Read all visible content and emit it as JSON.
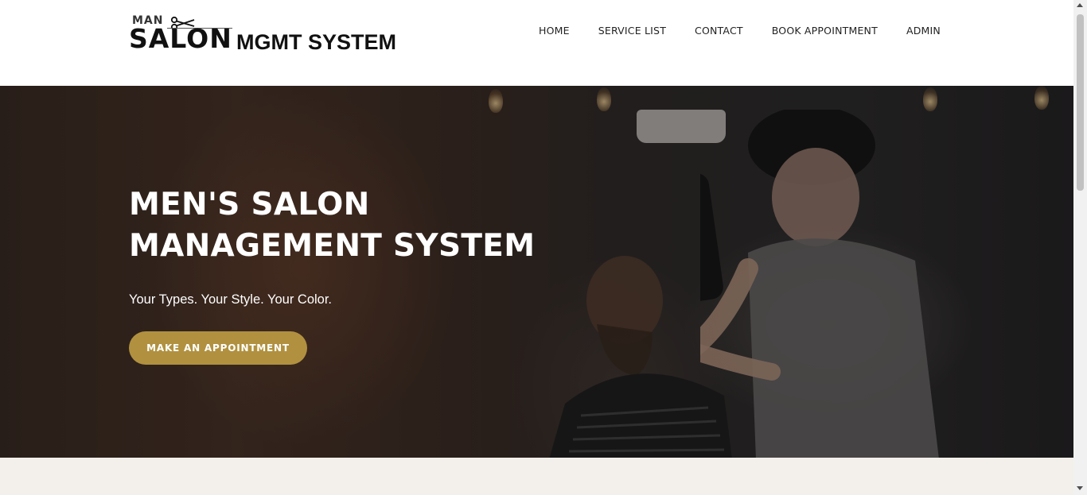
{
  "header": {
    "logo": {
      "top_word": "MAN",
      "main_word": "SALON",
      "suffix": "MGMT SYSTEM"
    },
    "nav": [
      {
        "label": "HOME"
      },
      {
        "label": "SERVICE LIST"
      },
      {
        "label": "CONTACT"
      },
      {
        "label": "BOOK APPOINTMENT"
      },
      {
        "label": "ADMIN"
      }
    ]
  },
  "hero": {
    "title_line1": "MEN'S SALON",
    "title_line2": "MANAGEMENT SYSTEM",
    "subtitle": "Your Types. Your Style. Your Color.",
    "button_label": "MAKE AN APPOINTMENT",
    "accent_color": "#b1913f"
  },
  "icons": [
    "scissors-icon"
  ]
}
